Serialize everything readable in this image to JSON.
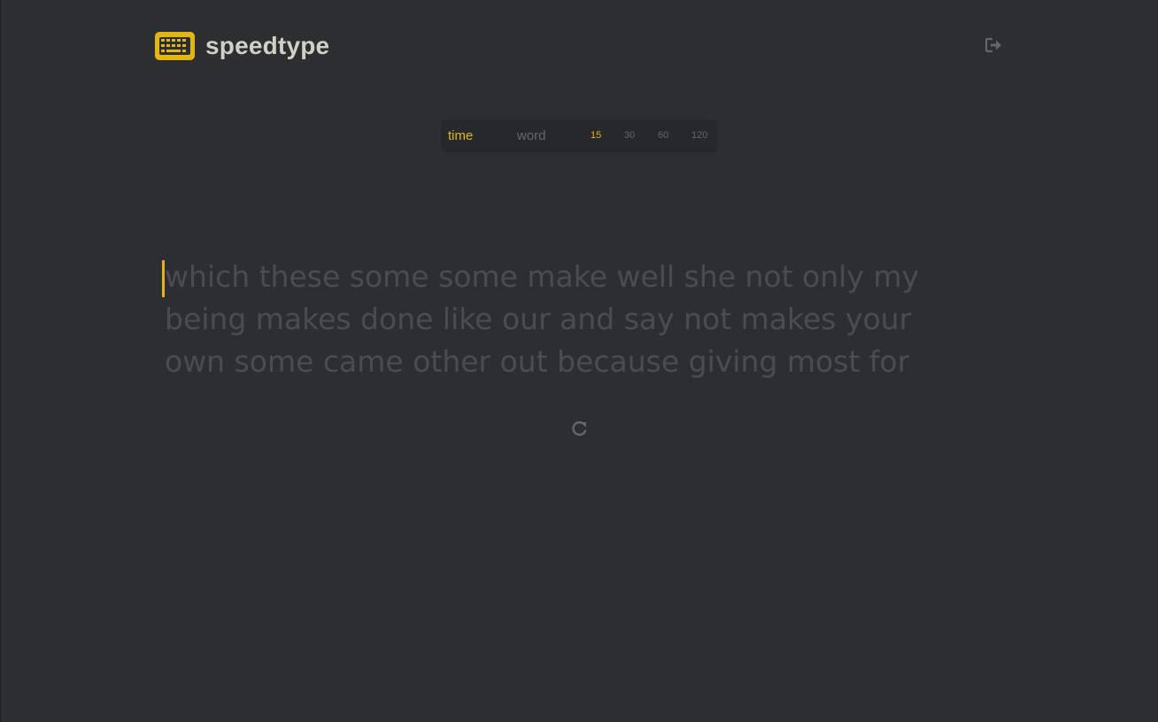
{
  "app": {
    "name": "speedtype",
    "accent_color": "#e2b714",
    "background_color": "#2d2e32",
    "text_color": "#d1d0c5",
    "untyped_color": "#4b4c50"
  },
  "header": {
    "logo_icon": "keyboard-icon",
    "logout_icon": "sign-out-icon"
  },
  "mode_bar": {
    "modes": [
      "time",
      "word"
    ],
    "active_mode": "time",
    "durations": [
      "15",
      "30",
      "60",
      "120"
    ],
    "active_duration": "15"
  },
  "typing": {
    "lines": [
      "which these some some make well she not only my",
      "being makes done like our and say not makes your",
      "own some came other out because giving most for"
    ]
  },
  "controls": {
    "restart_icon": "redo-icon"
  }
}
